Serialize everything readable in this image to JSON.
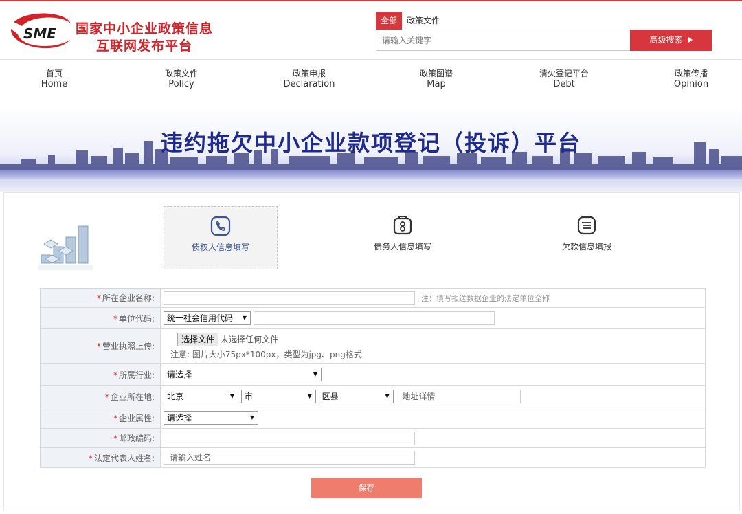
{
  "header": {
    "logo_abbr": "SME",
    "logo_line1": "国家中小企业政策信息",
    "logo_line2": "互联网发布平台",
    "search_tabs": [
      "全部",
      "政策文件"
    ],
    "search_placeholder": "请输入关键字",
    "advanced_search": "高级搜索",
    "accent_color": "#d7373c"
  },
  "nav": [
    {
      "cn": "首页",
      "en": "Home"
    },
    {
      "cn": "政策文件",
      "en": "Policy"
    },
    {
      "cn": "政策申报",
      "en": "Declaration"
    },
    {
      "cn": "政策图谱",
      "en": "Map"
    },
    {
      "cn": "清欠登记平台",
      "en": "Debt"
    },
    {
      "cn": "政策传播",
      "en": "Opinion"
    }
  ],
  "banner": {
    "title": "违约拖欠中小企业款项登记（投诉）平台"
  },
  "steps": [
    {
      "label": "债权人信息填写",
      "icon": "phone-icon",
      "active": true
    },
    {
      "label": "债务人信息填写",
      "icon": "badge-icon",
      "active": false
    },
    {
      "label": "欠款信息填报",
      "icon": "list-icon",
      "active": false
    }
  ],
  "form": {
    "required_mark": "*",
    "company_name": {
      "label": "所在企业名称:",
      "value": "",
      "note": "注：填写报送数据企业的法定单位全称"
    },
    "unit_code": {
      "label": "单位代码:",
      "type_selected": "统一社会信用代码",
      "value": ""
    },
    "license_upload": {
      "label": "营业执照上传:",
      "button": "选择文件",
      "no_file": "未选择任何文件",
      "hint": "注意: 图片大小75px*100px，类型为jpg、png格式"
    },
    "industry": {
      "label": "所属行业:",
      "selected": "请选择"
    },
    "location": {
      "label": "企业所在地:",
      "province": "北京",
      "city": "市",
      "district": "区县",
      "address_placeholder": "地址详情"
    },
    "attribute": {
      "label": "企业属性:",
      "selected": "请选择"
    },
    "postal_code": {
      "label": "邮政编码:",
      "value": ""
    },
    "legal_rep": {
      "label": "法定代表人姓名:",
      "placeholder": "请输入姓名"
    },
    "save": "保存"
  },
  "colors": {
    "banner_title": "#1e2a8c",
    "save_button": "#ef7d6d",
    "label_bg": "#eff3f8"
  }
}
